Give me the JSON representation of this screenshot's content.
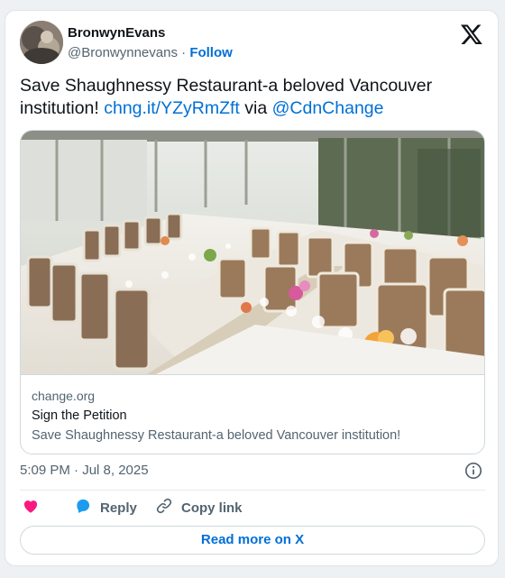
{
  "author": {
    "display_name": "BronwynEvans",
    "handle": "@Bronwynnevans",
    "separator": " · ",
    "follow_label": "Follow"
  },
  "tweet": {
    "text_plain": "Save Shaughnessy Restaurant-a beloved Vancouver institution! ",
    "link_text": "chng.it/YZyRmZft",
    "via_text": " via ",
    "mention_text": "@CdnChange"
  },
  "link_card": {
    "domain": "change.org",
    "title": "Sign the Petition",
    "description": "Save Shaughnessy Restaurant-a beloved Vancouver institution!"
  },
  "timestamp": "5:09 PM · Jul 8, 2025",
  "actions": {
    "like_label": "",
    "reply_label": "Reply",
    "copy_link_label": "Copy link"
  },
  "read_more_label": "Read more on X",
  "icons": {
    "logo": "x-logo-icon",
    "info": "info-icon",
    "like": "heart-icon",
    "reply": "speech-bubble-icon",
    "copy": "link-icon"
  },
  "colors": {
    "accent": "#006fd6",
    "like": "#f91880",
    "reply": "#1d9bf0",
    "muted": "#536471"
  }
}
